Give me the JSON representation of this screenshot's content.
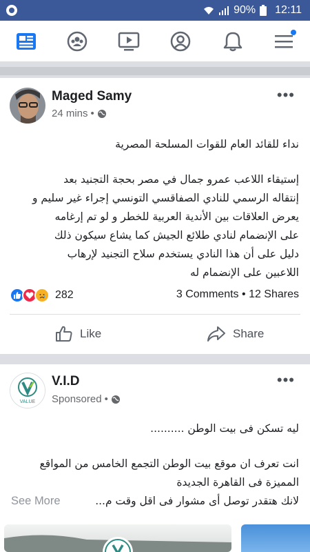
{
  "status_bar": {
    "battery": "90%",
    "time": "12:11",
    "icons": [
      "app-notification-icon",
      "wifi-icon",
      "signal-icon",
      "battery-icon"
    ]
  },
  "nav": {
    "items": [
      "news-feed-icon",
      "groups-icon",
      "watch-icon",
      "profile-icon",
      "notifications-icon",
      "menu-icon"
    ],
    "accent_color": "#1877f2"
  },
  "post1": {
    "author": "Maged Samy",
    "time": "24 mins",
    "separator": "•",
    "title": "نداء للقائد العام للقوات المسلحة المصرية",
    "body_lines": [
      "إستيقاء اللاعب عمرو جمال في مصر بحجة التجنيد بعد",
      "إنتقاله الرسمي للنادي الصفاقسي التونسي إجراء غير سليم و",
      "يعرض العلاقات بين الأندية العربية للخطر و لو تم إرغامه",
      "على الإنضمام لنادي طلائع الجيش كما يشاع سيكون ذلك",
      "دليل على أن هذا النادي يستخدم سلاح التجنيد لإرهاب",
      "اللاعبين على الإنضمام له"
    ],
    "reaction_count": "282",
    "comments": "3 Comments",
    "shares": "12 Shares",
    "like_label": "Like",
    "share_label": "Share"
  },
  "post2": {
    "author": "V.I.D",
    "sponsored": "Sponsored",
    "separator": "•",
    "logo_text": "VALUE",
    "lines": [
      "ليه تسكن فى بيت الوطن ..........",
      "انت تعرف ان موقع بيت الوطن التجمع الخامس من المواقع",
      "المميزة فى القاهرة الجديدة",
      "لانك هتقدر توصل أى مشوار فى اقل وقت م..."
    ],
    "see_more": "See More"
  }
}
